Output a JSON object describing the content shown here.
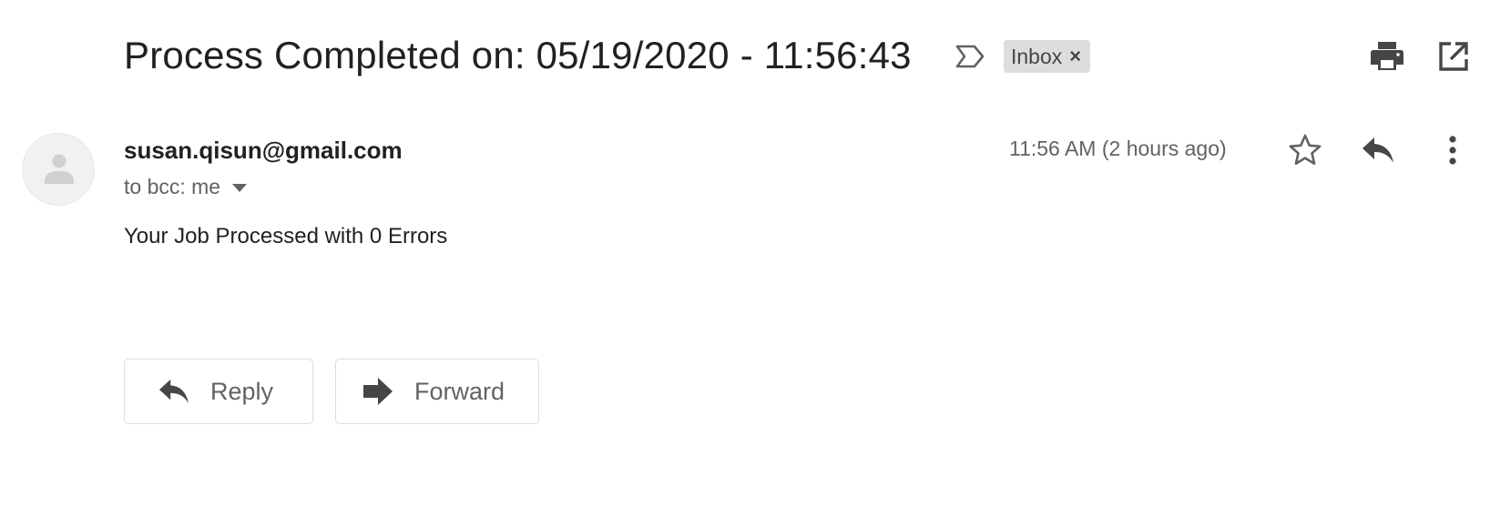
{
  "message": {
    "subject": "Process Completed on: 05/19/2020 - 11:56:43",
    "label": "Inbox",
    "label_close": "×",
    "sender": "susan.qisun@gmail.com",
    "recipients": "to bcc: me",
    "timestamp": "11:56 AM (2 hours ago)",
    "body": "Your Job Processed with 0 Errors"
  },
  "actions": {
    "reply_label": "Reply",
    "forward_label": "Forward"
  },
  "icons": {
    "importance": "label-importance-outline-icon",
    "print": "print-icon",
    "popout": "open-in-new-window-icon",
    "avatar": "default-person-avatar",
    "recipients_caret": "caret-down-icon",
    "star": "star-outline-icon",
    "reply": "reply-arrow-icon",
    "more": "vertical-ellipsis-icon",
    "forward": "forward-arrow-icon"
  },
  "colors": {
    "text_primary": "#202124",
    "text_secondary": "#5f6368",
    "chip_bg": "#dddddd",
    "icon_dark": "#444746",
    "button_border": "#dadce0"
  }
}
